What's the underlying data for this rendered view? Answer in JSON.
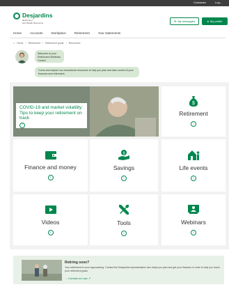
{
  "topbar": {
    "link1": "Contactez",
    "link2": "Log..."
  },
  "logo": {
    "name": "Desjardins",
    "line1": "Retirement",
    "line2": "and Wealth Resources"
  },
  "header": {
    "messages_label": "My messages",
    "profile_label": "My profile"
  },
  "nav": {
    "items": [
      "Home",
      "Accounts",
      "Workplace",
      "Retirement",
      "Your statements"
    ]
  },
  "breadcrumb": {
    "items": [
      "Home",
      "Retirement",
      "Retirement guide",
      "Resources"
    ]
  },
  "chat": {
    "bubble1": "Welcome to your Retirement Wellness Centre!",
    "bubble2": "Come and explore our educational resources to help you plan and take control of your finances and retirement."
  },
  "feature": {
    "title": "COVID-19 and market volatility: Tips to keep your retirement on track"
  },
  "tiles": {
    "retirement": "Retirement",
    "finance": "Finance and money",
    "savings": "Savings",
    "life_events": "Life events",
    "videos": "Videos",
    "tools": "Tools",
    "webinars": "Webinars"
  },
  "retiring": {
    "title": "Retiring soon?",
    "text": "Your retirement is soon approaching. Contact the Desjardins representative who helps you plan and get your finances in order to help you reach your retirement goals.",
    "link": "Contact us now"
  },
  "colors": {
    "brand": "#00874e"
  }
}
